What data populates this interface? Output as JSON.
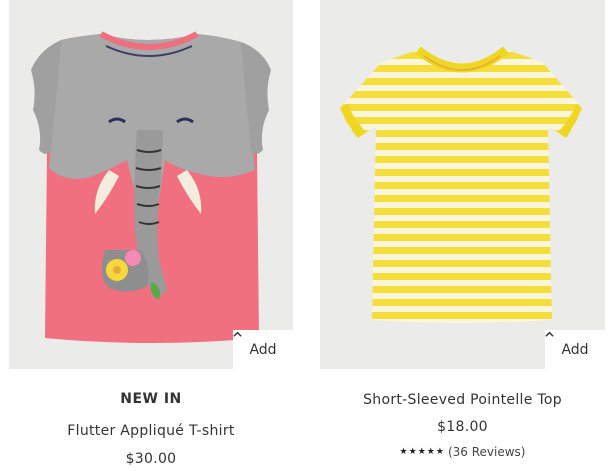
{
  "products": [
    {
      "badge": "NEW IN",
      "name": "Flutter Appliqué T-shirt",
      "price": "$30.00",
      "add_label": "Add",
      "image_icon": "elephant-tshirt-image",
      "colors": {
        "body": "#f0707f",
        "grey": "#a9a9a9"
      }
    },
    {
      "name": "Short-Sleeved Pointelle Top",
      "price": "$18.00",
      "add_label": "Add",
      "rating_stars": 5,
      "reviews": "(36 Reviews)",
      "image_icon": "striped-top-image",
      "colors": {
        "stripe_yellow": "#f3de3c",
        "stripe_white": "#fbf6da"
      }
    }
  ],
  "colors": {
    "image_bg": "#ebebea",
    "text": "#333333"
  }
}
